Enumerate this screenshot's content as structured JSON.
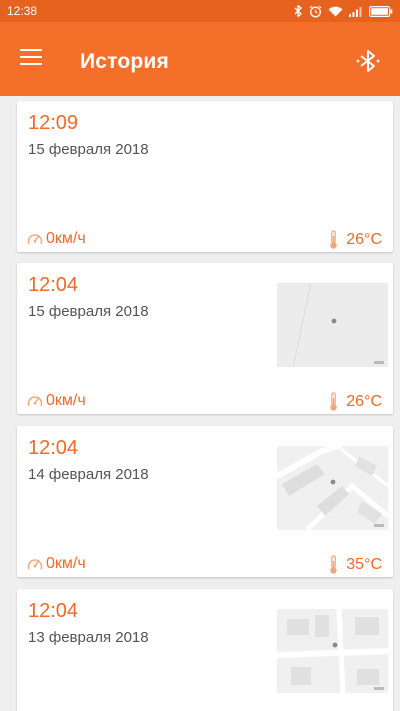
{
  "status_bar": {
    "time": "12:38",
    "icons": [
      "bluetooth-icon",
      "alarm-icon",
      "wifi-icon",
      "signal-icon",
      "battery-icon"
    ]
  },
  "app_bar": {
    "title": "История",
    "menu_icon": "hamburger-menu-icon",
    "action_icon": "bluetooth-icon"
  },
  "colors": {
    "accent": "#f36f2a",
    "status_bar": "#e8621f",
    "background": "#efefef",
    "card": "#ffffff",
    "text_secondary": "#555555"
  },
  "history": [
    {
      "time": "12:09",
      "date": "15 февраля 2018",
      "speed": "0км/ч",
      "temperature": "26°C",
      "has_map": false
    },
    {
      "time": "12:04",
      "date": "15 февраля 2018",
      "speed": "0км/ч",
      "temperature": "26°C",
      "has_map": true
    },
    {
      "time": "12:04",
      "date": "14 февраля 2018",
      "speed": "0км/ч",
      "temperature": "35°C",
      "has_map": true
    },
    {
      "time": "12:04",
      "date": "13 февраля 2018",
      "speed": "",
      "temperature": "",
      "has_map": true
    }
  ]
}
